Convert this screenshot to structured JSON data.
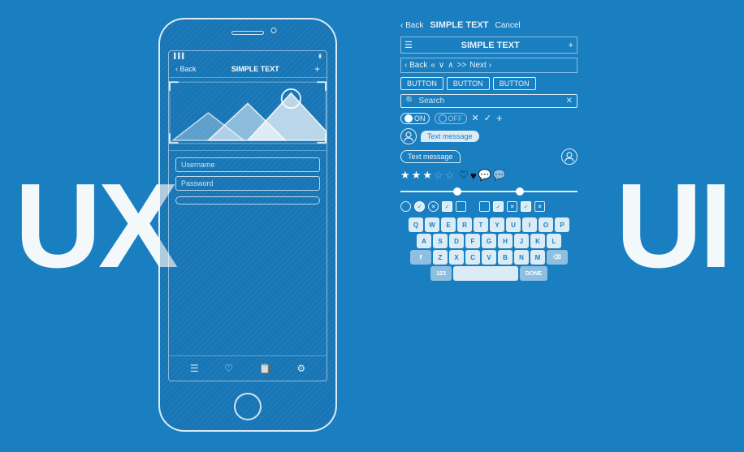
{
  "labels": {
    "ux": "UX",
    "ui": "UI",
    "simple_text": "SIMPLE TEXT",
    "back": "‹ Back",
    "cancel": "Cancel",
    "next": "Next ›",
    "plus": "+",
    "search": "Search",
    "on": "ON",
    "off": "OFF",
    "text_message": "Text message",
    "button": "BUTTON",
    "username": "Username",
    "password": "Password",
    "done": "DONE",
    "num123": "123"
  },
  "keyboard": {
    "row1": [
      "Q",
      "W",
      "E",
      "R",
      "T",
      "Y",
      "U",
      "I",
      "O",
      "P"
    ],
    "row2": [
      "A",
      "S",
      "D",
      "F",
      "G",
      "H",
      "J",
      "K",
      "L"
    ],
    "row3": [
      "Z",
      "X",
      "C",
      "V",
      "B",
      "N",
      "M"
    ],
    "bottom_left": "123",
    "bottom_right": "DONE"
  },
  "stars": {
    "filled": 3,
    "empty": 2
  },
  "colors": {
    "background": "#1a7fc1",
    "white": "#ffffff",
    "key_text": "#1a7fc1"
  }
}
